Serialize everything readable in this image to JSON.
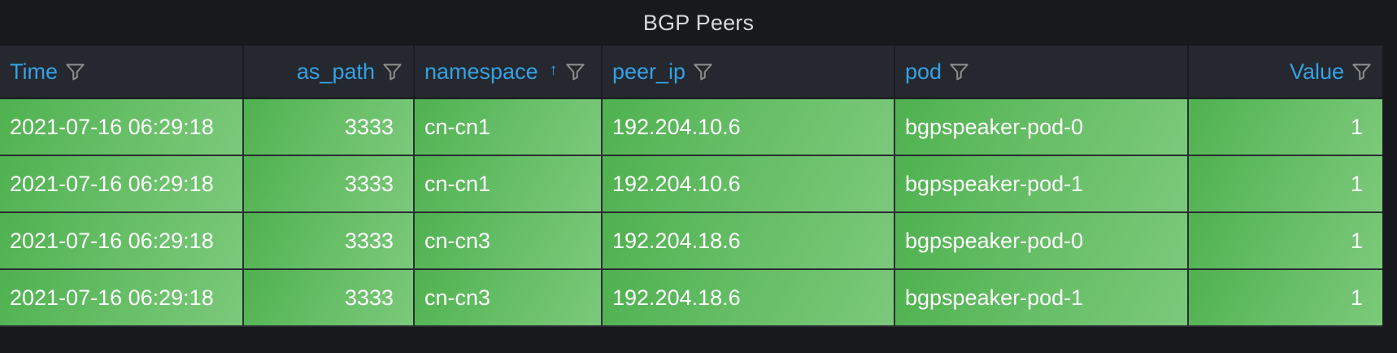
{
  "panel": {
    "title": "BGP Peers"
  },
  "table": {
    "columns": [
      {
        "key": "time",
        "label": "Time",
        "sorted": false
      },
      {
        "key": "as_path",
        "label": "as_path",
        "sorted": false
      },
      {
        "key": "namespace",
        "label": "namespace",
        "sorted": true,
        "sort_direction": "ascending",
        "sort_indicator": "↑"
      },
      {
        "key": "peer_ip",
        "label": "peer_ip",
        "sorted": false
      },
      {
        "key": "pod",
        "label": "pod",
        "sorted": false
      },
      {
        "key": "value",
        "label": "Value",
        "sorted": false
      }
    ],
    "rows": [
      {
        "time": "2021-07-16 06:29:18",
        "as_path": "3333",
        "namespace": "cn-cn1",
        "peer_ip": "192.204.10.6",
        "pod": "bgpspeaker-pod-0",
        "value": "1"
      },
      {
        "time": "2021-07-16 06:29:18",
        "as_path": "3333",
        "namespace": "cn-cn1",
        "peer_ip": "192.204.10.6",
        "pod": "bgpspeaker-pod-1",
        "value": "1"
      },
      {
        "time": "2021-07-16 06:29:18",
        "as_path": "3333",
        "namespace": "cn-cn3",
        "peer_ip": "192.204.18.6",
        "pod": "bgpspeaker-pod-0",
        "value": "1"
      },
      {
        "time": "2021-07-16 06:29:18",
        "as_path": "3333",
        "namespace": "cn-cn3",
        "peer_ip": "192.204.18.6",
        "pod": "bgpspeaker-pod-1",
        "value": "1"
      }
    ]
  },
  "colors": {
    "background": "#18191d",
    "header_background": "#25282e",
    "header_text": "#33a2e5",
    "row_green_dark": "#4fb14f",
    "row_green_light": "#7cc97b",
    "title_text": "#d8d9da",
    "cell_text": "#ffffff"
  },
  "icons": {
    "filter": "filter-icon",
    "sort": "sort-ascending-icon"
  }
}
